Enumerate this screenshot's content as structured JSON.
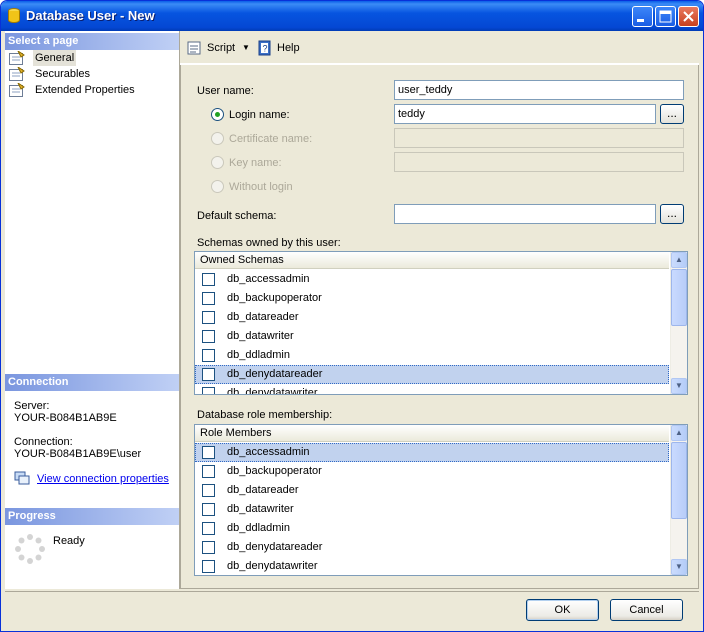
{
  "window": {
    "title": "Database User - New"
  },
  "left": {
    "select_page_header": "Select a page",
    "pages": [
      {
        "label": "General"
      },
      {
        "label": "Securables"
      },
      {
        "label": "Extended Properties"
      }
    ],
    "connection_header": "Connection",
    "server_label": "Server:",
    "server_value": "YOUR-B084B1AB9E",
    "connection_label": "Connection:",
    "connection_value": "YOUR-B084B1AB9E\\user",
    "view_conn_props": "View connection properties",
    "progress_header": "Progress",
    "progress_status": "Ready"
  },
  "toolbar": {
    "script_label": "Script",
    "help_label": "Help"
  },
  "form": {
    "user_name_label": "User name:",
    "user_name_value": "user_teddy",
    "login_name_label": "Login name:",
    "login_name_value": "teddy",
    "certificate_name_label": "Certificate name:",
    "key_name_label": "Key name:",
    "without_login_label": "Without login",
    "default_schema_label": "Default schema:",
    "default_schema_value": "",
    "browse_label": "...",
    "schemas_owned_label": "Schemas owned by this user:",
    "role_membership_label": "Database role membership:"
  },
  "owned_schemas": {
    "header": "Owned Schemas",
    "rows": [
      {
        "name": "db_accessadmin"
      },
      {
        "name": "db_backupoperator"
      },
      {
        "name": "db_datareader"
      },
      {
        "name": "db_datawriter"
      },
      {
        "name": "db_ddladmin"
      },
      {
        "name": "db_denydatareader"
      },
      {
        "name": "db_denydatawriter"
      }
    ]
  },
  "role_members": {
    "header": "Role Members",
    "rows": [
      {
        "name": "db_accessadmin"
      },
      {
        "name": "db_backupoperator"
      },
      {
        "name": "db_datareader"
      },
      {
        "name": "db_datawriter"
      },
      {
        "name": "db_ddladmin"
      },
      {
        "name": "db_denydatareader"
      },
      {
        "name": "db_denydatawriter"
      }
    ]
  },
  "buttons": {
    "ok": "OK",
    "cancel": "Cancel"
  }
}
